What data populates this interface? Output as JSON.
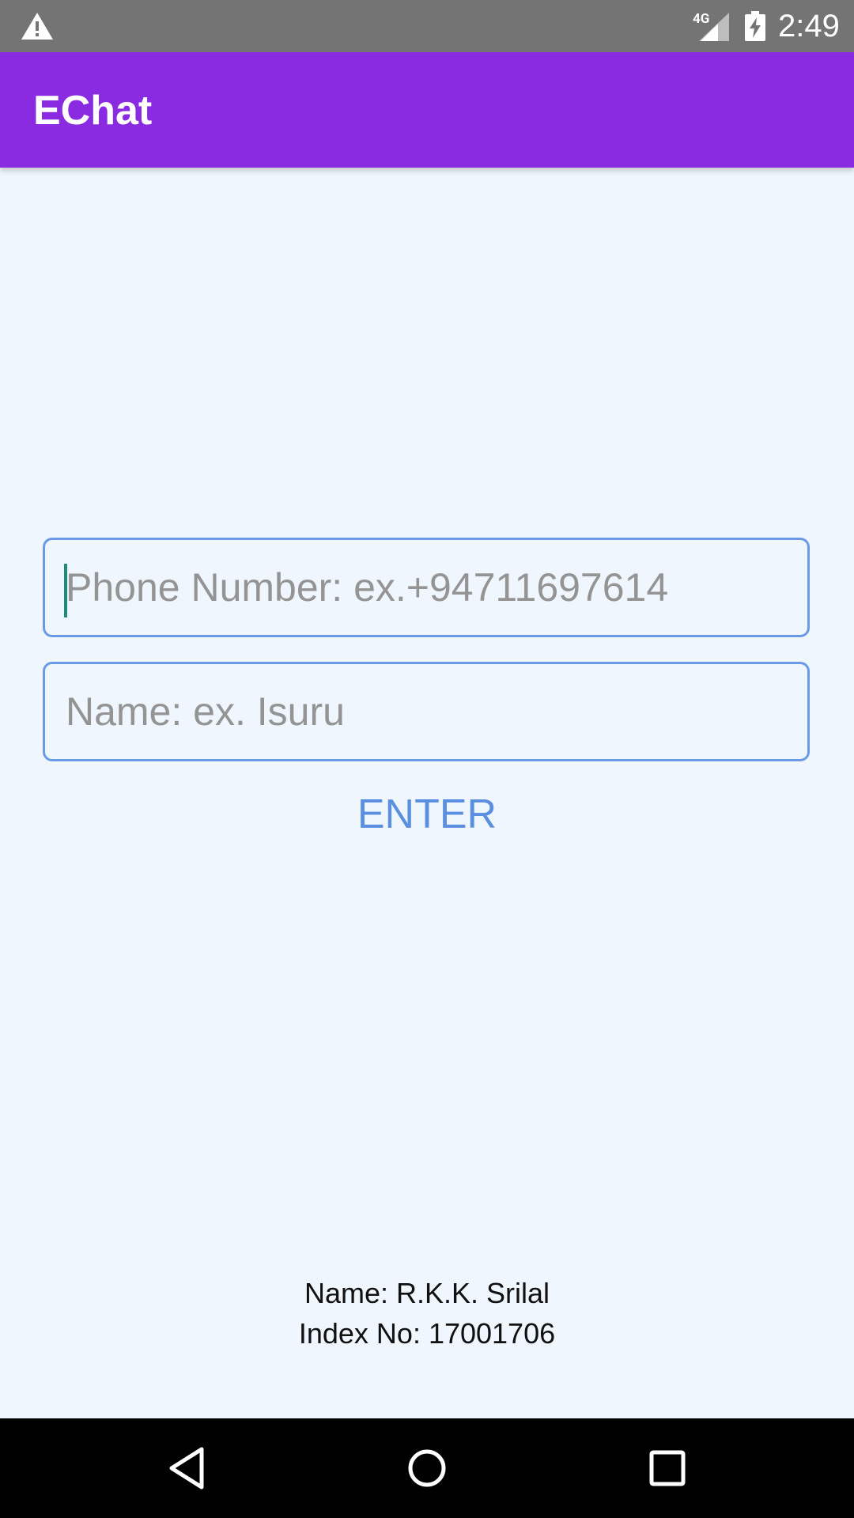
{
  "status_bar": {
    "network": "4G",
    "time": "2:49",
    "icons": [
      "warning-icon",
      "signal-icon",
      "battery-charging-icon"
    ]
  },
  "app_bar": {
    "title": "EChat",
    "color": "#8a2be2"
  },
  "form": {
    "phone_placeholder": "Phone Number: ex.+94711697614",
    "phone_value": "",
    "name_placeholder": "Name: ex. Isuru",
    "name_value": "",
    "enter_label": "ENTER",
    "accent": "#6a9ae6"
  },
  "footer": {
    "name": "Name: R.K.K. Srilal",
    "index": "Index No: 17001706"
  },
  "nav_bar": {
    "icons": [
      "back-icon",
      "home-icon",
      "recents-icon"
    ]
  }
}
